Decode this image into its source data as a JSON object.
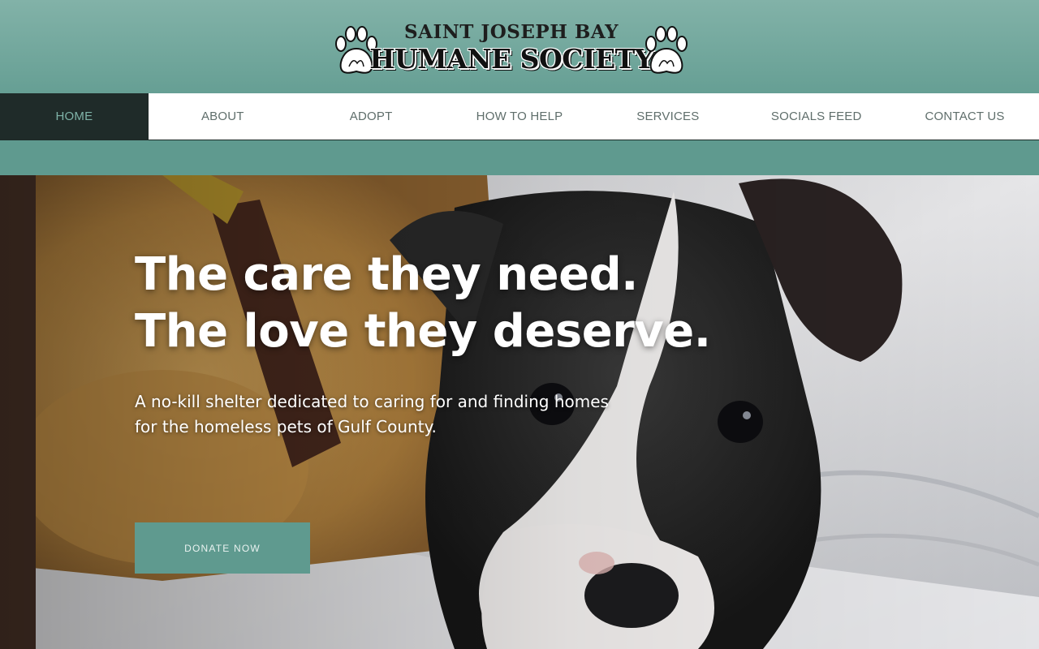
{
  "header": {
    "logo_top": "SAINT JOSEPH BAY",
    "logo_bottom": "HUMANE SOCIETY",
    "left_icon": "paw-print-icon",
    "right_icon": "paw-print-icon"
  },
  "nav": {
    "items": [
      {
        "label": "HOME",
        "active": true
      },
      {
        "label": "ABOUT"
      },
      {
        "label": "ADOPT"
      },
      {
        "label": "HOW TO HELP"
      },
      {
        "label": "SERVICES"
      },
      {
        "label": "SOCIALS FEED"
      },
      {
        "label": "CONTACT US"
      }
    ]
  },
  "hero": {
    "headline_line1": "The care they need.",
    "headline_line2": "The love they deserve.",
    "subtext_line1": "A no-kill shelter dedicated to caring for and finding homes",
    "subtext_line2": "for the homeless pets of Gulf County.",
    "donate_label": "DONATE NOW"
  },
  "colors": {
    "header_teal": "#82b2a8",
    "nav_active": "#1f2b29",
    "nav_active_text": "#7fb3a8",
    "button": "#5f9a8f"
  }
}
